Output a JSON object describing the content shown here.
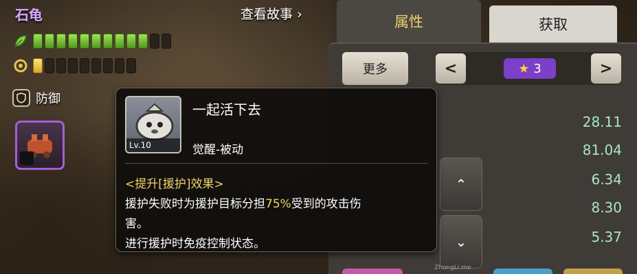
{
  "character": {
    "name": "石龟",
    "story_link": "查看故事",
    "role": "防御",
    "health_bars": {
      "filled": 10,
      "total": 12
    },
    "energy_bars": {
      "filled": 1,
      "total": 9
    }
  },
  "tabs": [
    {
      "label": "属性",
      "active": true
    },
    {
      "label": "获取",
      "active": false
    }
  ],
  "panel": {
    "more_label": "更多",
    "prev_icon": "<",
    "next_icon": ">",
    "star_level": "3",
    "stat_values": [
      "28.11",
      "81.04",
      "6.34",
      "8.30",
      "5.37"
    ]
  },
  "skill": {
    "name": "一起活下去",
    "level": "Lv.10",
    "type": "觉醒-被动",
    "heading": "<提升[援护]效果>",
    "desc_line1_pre": "援护失败时为援护目标分担",
    "desc_line1_hl": "75%",
    "desc_line1_post": "受到的攻击伤",
    "desc_line2": "害。",
    "desc_line3": "进行援护时免疫控制状态。"
  },
  "watermark": "ZhongLi.me",
  "colors": {
    "name_purple": "#d9a9ff",
    "stat_green": "#a9e6c8",
    "highlight_yellow": "#f0d36a",
    "star_purple": "#7b3fc8"
  },
  "icons": {
    "health": "leaf-icon",
    "energy": "swirl-icon",
    "role": "shield-icon",
    "star": "star-icon"
  }
}
